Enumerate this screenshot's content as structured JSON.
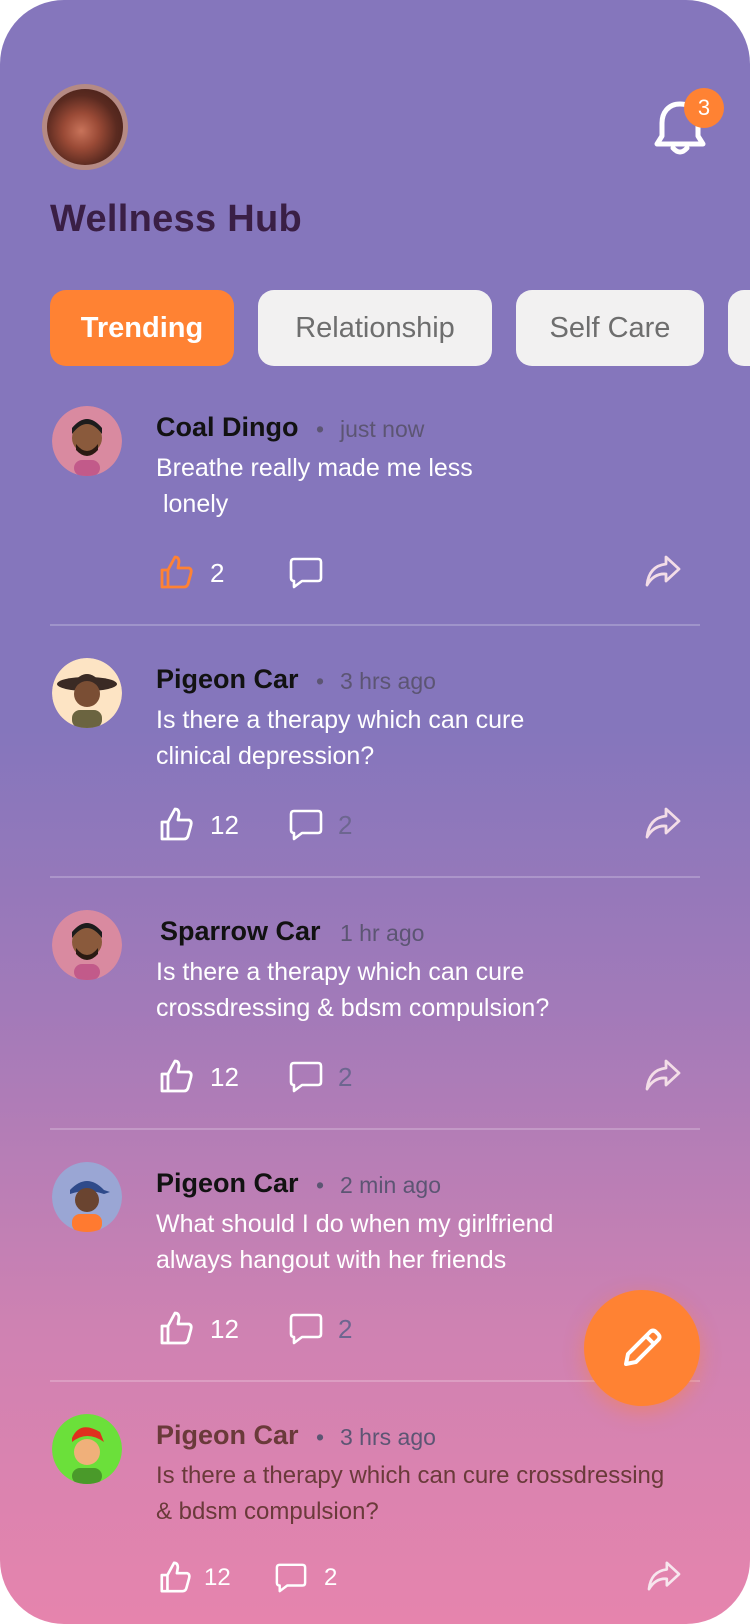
{
  "header": {
    "title": "Wellness Hub",
    "notification_count": "3"
  },
  "tabs": [
    {
      "label": "Trending",
      "active": true
    },
    {
      "label": "Relationship",
      "active": false
    },
    {
      "label": "Self Care",
      "active": false
    }
  ],
  "posts": [
    {
      "author": "Coal Dingo",
      "time": "just now",
      "text": "Breathe really made me less\n lonely",
      "likes": "2",
      "comments": "",
      "liked": true
    },
    {
      "author": "Pigeon Car",
      "time": "3 hrs ago",
      "text": "Is there a therapy which can cure\nclinical depression?",
      "likes": "12",
      "comments": "2",
      "liked": false
    },
    {
      "author": "Sparrow Car",
      "time": "1 hr ago",
      "text": "Is there a therapy which can cure\ncrossdressing & bdsm compulsion?",
      "likes": "12",
      "comments": "2",
      "liked": false
    },
    {
      "author": "Pigeon Car",
      "time": "2 min ago",
      "text": "What should I do when my girlfriend\nalways hangout with her friends",
      "likes": "12",
      "comments": "2",
      "liked": false
    },
    {
      "author": "Pigeon Car",
      "time": "3 hrs ago",
      "text": "Is there a therapy which can cure crossdressing\n& bdsm compulsion?",
      "likes": "12",
      "comments": "2",
      "liked": false
    }
  ],
  "colors": {
    "accent": "#ff8233",
    "title": "#3a1f45"
  },
  "icons": {
    "notifications": "bell-icon",
    "like": "thumbs-up-icon",
    "comment": "comment-icon",
    "share": "share-icon",
    "compose": "pencil-icon"
  }
}
